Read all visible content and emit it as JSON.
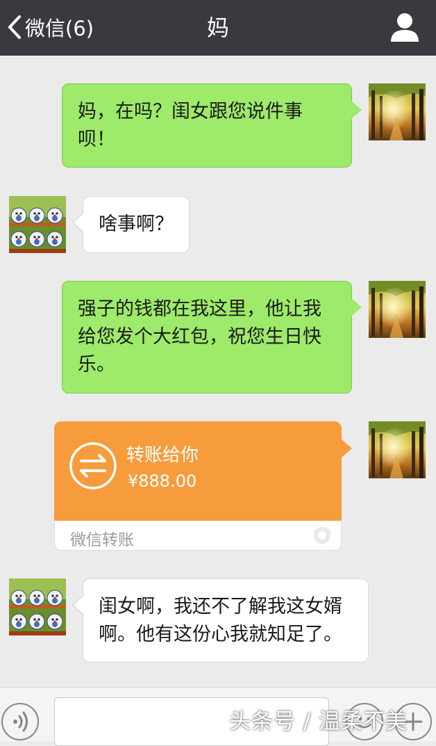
{
  "header": {
    "back_label": "微信(6)",
    "title": "妈"
  },
  "messages": [
    {
      "sender": "me",
      "text": "妈，在吗？闺女跟您说件事\n呗！"
    },
    {
      "sender": "mom",
      "text": "啥事啊？"
    },
    {
      "sender": "me",
      "text": "强子的钱都在我这里，他让我\n给您发个大红包，祝您生日快\n乐。"
    },
    {
      "sender": "me",
      "type": "transfer",
      "title": "转账给你",
      "amount": "¥888.00",
      "label": "微信转账"
    },
    {
      "sender": "mom",
      "text": "闺女啊，我还不了解我这女婿\n啊。他有这份心我就知足了。"
    }
  ],
  "watermark": "头条号 / 温柔不美",
  "colors": {
    "header_bg": "#393a3f",
    "chat_bg": "#ebebeb",
    "my_bubble": "#9eea6a",
    "their_bubble": "#ffffff",
    "transfer": "#f79c3c"
  },
  "icons": {
    "back": "chevron-left-icon",
    "profile": "person-icon",
    "transfer": "transfer-arrows-icon",
    "voice": "voice-icon",
    "emoji": "emoji-icon",
    "plus": "plus-icon"
  }
}
